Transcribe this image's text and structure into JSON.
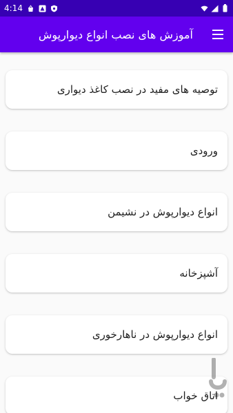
{
  "status_bar": {
    "time": "4:14",
    "left_icons": [
      "shopping-bag-icon",
      "warning-icon",
      "shield-icon"
    ],
    "right_icons": [
      "wifi-icon",
      "signal-icon",
      "battery-icon"
    ]
  },
  "app_bar": {
    "title": "آموزش های نصب انواع دیوارپوش",
    "menu_icon": "hamburger-menu-icon"
  },
  "colors": {
    "primary": "#6200ee",
    "status_bar": "#3700b3",
    "background": "#fafafa",
    "card": "#ffffff"
  },
  "items": [
    {
      "label": "توصیه های مفید در نصب کاغذ دیواری"
    },
    {
      "label": "ورودی"
    },
    {
      "label": "انواع دیوارپوش در نشیمن"
    },
    {
      "label": "آشپزخانه"
    },
    {
      "label": "انواع دیوارپوش در ناهارخوری"
    },
    {
      "label": "اتاق خواب"
    }
  ]
}
